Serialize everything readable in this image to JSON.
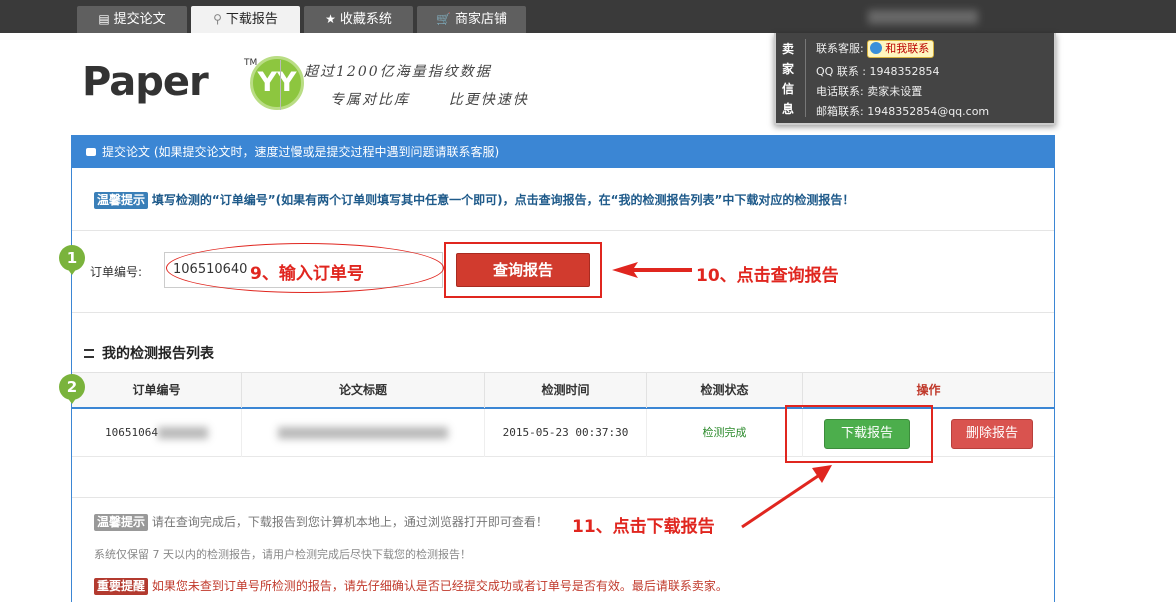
{
  "tabs": [
    {
      "icon": "document-icon",
      "label": "提交论文"
    },
    {
      "icon": "search-icon",
      "label": "下载报告",
      "active": true
    },
    {
      "icon": "star-icon",
      "label": "收藏系统"
    },
    {
      "icon": "cart-icon",
      "label": "商家店铺"
    }
  ],
  "seller": {
    "side_chars": [
      "卖",
      "家",
      "信",
      "息"
    ],
    "service_label": "联系客服:",
    "service_button": "和我联系",
    "qq_line": "QQ 联系 : 1948352854",
    "phone_line": "电话联系: 卖家未设置",
    "email_line": "邮箱联系: 1948352854@qq.com"
  },
  "logo": {
    "brand": "Paper",
    "badge": "YY",
    "tm": "TM",
    "slogan_line1": "超过1200亿海量指纹数据",
    "slogan_line2": "专属对比库      比更快速快"
  },
  "panel": {
    "header": "提交论文 (如果提交论文时，速度过慢或是提交过程中遇到问题请联系客服)",
    "hint_tag": "温馨提示",
    "hint_text": "填写检测的“订单编号”(如果有两个订单则填写其中任意一个即可)，点击查询报告，在“我的检测报告列表”中下载对应的检测报告！",
    "order_label": "订单编号:",
    "order_value": "106510640",
    "query_button": "查询报告",
    "list_title": "我的检测报告列表",
    "table": {
      "headers": [
        "订单编号",
        "论文标题",
        "检测时间",
        "检测状态",
        "操作"
      ],
      "row": {
        "order_no": "10651064",
        "title": "",
        "time": "2015-05-23 00:37:30",
        "status": "检测完成"
      },
      "download_button": "下载报告",
      "delete_button": "删除报告"
    },
    "note1_tag": "温馨提示",
    "note1_text": "请在查询完成后，下载报告到您计算机本地上，通过浏览器打开即可查看！",
    "note2_text": "系统仅保留 7 天以内的检测报告，请用户检测完成后尽快下载您的检测报告！",
    "note3_tag": "重要提醒",
    "note3_text": "如果您未查到订单号所检测的报告，请先仔细确认是否已经提交成功或者订单号是否有效。最后请联系卖家。"
  },
  "steps": [
    "1",
    "2"
  ],
  "annotations": {
    "step9": "9、输入订单号",
    "step10": "10、点击查询报告",
    "step11": "11、点击下载报告"
  },
  "colors": {
    "accent_blue": "#3b86d4",
    "annotation_red": "#e0261f",
    "step_green": "#7ab33c"
  }
}
